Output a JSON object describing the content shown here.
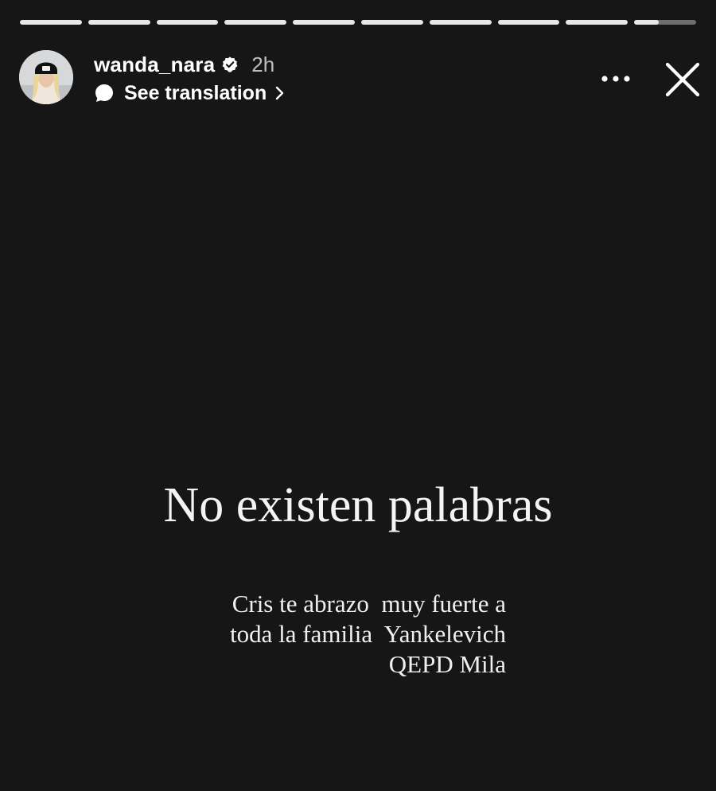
{
  "story": {
    "progress": {
      "segments_total": 10,
      "completed_segments": 9,
      "current_segment_fraction": 0.4
    },
    "header": {
      "username": "wanda_nara",
      "verified": true,
      "time": "2h",
      "translation_label": "See translation"
    },
    "content": {
      "headline": "No existen palabras",
      "message_lines": [
        "Cris te abrazo  muy fuerte a",
        "toda la familia  Yankelevich",
        "QEPD Mila"
      ]
    },
    "icons": {
      "verified": "verified-badge-icon",
      "translation": "speech-bubble-icon",
      "chevron": "chevron-right-icon",
      "more": "more-options-icon",
      "close": "close-icon"
    },
    "colors": {
      "background": "#161616",
      "text": "#ffffff",
      "progress_filled": "#e8e8e8",
      "progress_empty": "rgba(255,255,255,0.38)"
    }
  }
}
